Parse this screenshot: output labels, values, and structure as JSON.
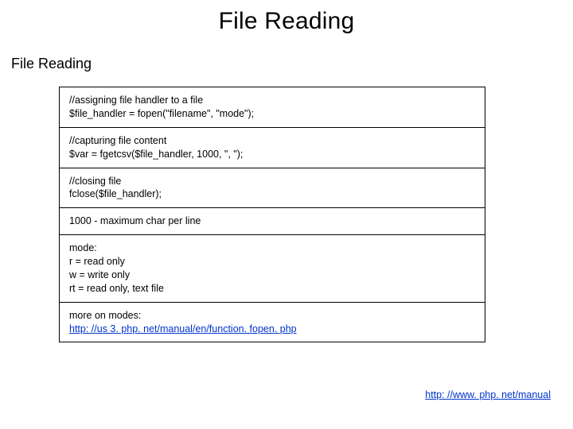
{
  "title": "File Reading",
  "subtitle": "File Reading",
  "sections": {
    "s1": {
      "l1": "//assigning file handler to a file",
      "l2": "$file_handler = fopen(\"filename\", \"mode\");"
    },
    "s2": {
      "l1": "//capturing file content",
      "l2": "$var = fgetcsv($file_handler, 1000, \", \");"
    },
    "s3": {
      "l1": "//closing file",
      "l2": "fclose($file_handler);"
    },
    "s4": {
      "l1": "1000 - maximum char per line"
    },
    "s5": {
      "l1": "mode:",
      "l2": "r = read only",
      "l3": "w = write only",
      "l4": "rt = read only, text file"
    },
    "s6": {
      "l1": "more on modes:",
      "link": "http: //us 3. php. net/manual/en/function. fopen. php"
    }
  },
  "footer": {
    "link": "http: //www. php. net/manual"
  }
}
